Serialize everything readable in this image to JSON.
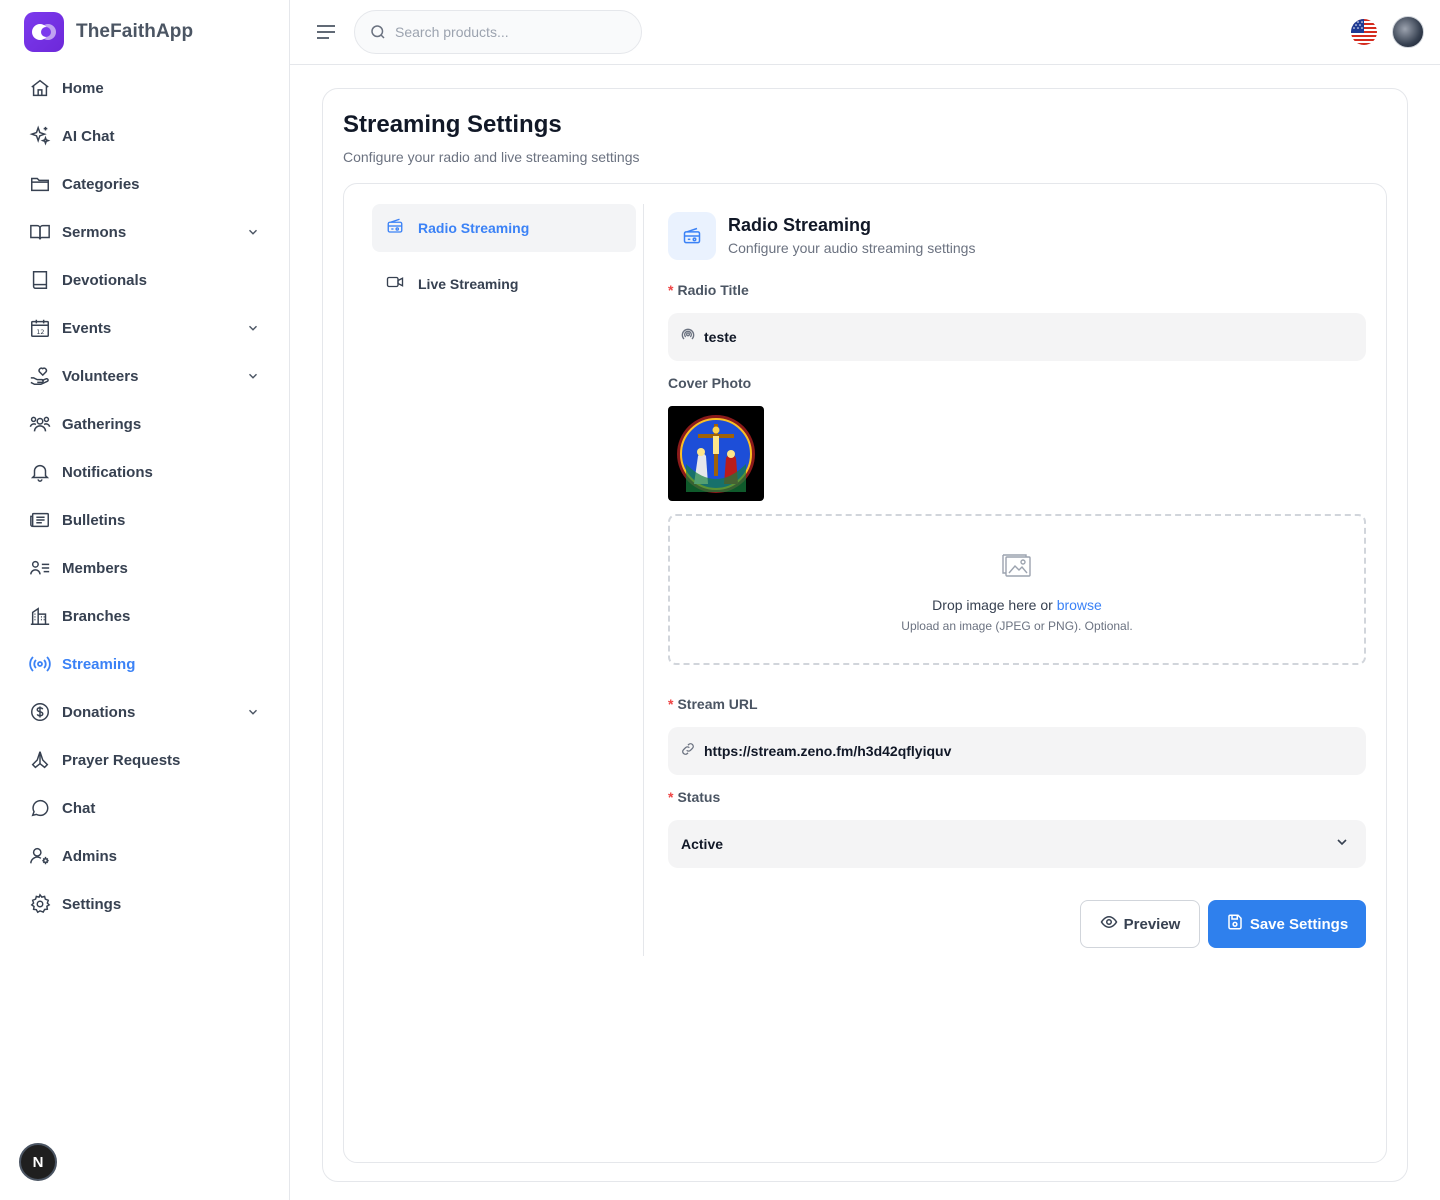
{
  "app": {
    "name": "TheFaithApp"
  },
  "search": {
    "placeholder": "Search products..."
  },
  "sidebar": {
    "items": [
      {
        "label": "Home",
        "icon": "home-icon"
      },
      {
        "label": "AI Chat",
        "icon": "sparkles-icon"
      },
      {
        "label": "Categories",
        "icon": "folder-icon"
      },
      {
        "label": "Sermons",
        "icon": "book-open-icon",
        "expandable": true
      },
      {
        "label": "Devotionals",
        "icon": "book-icon"
      },
      {
        "label": "Events",
        "icon": "calendar-icon",
        "expandable": true
      },
      {
        "label": "Volunteers",
        "icon": "hand-heart-icon",
        "expandable": true
      },
      {
        "label": "Gatherings",
        "icon": "users-icon"
      },
      {
        "label": "Notifications",
        "icon": "bell-icon"
      },
      {
        "label": "Bulletins",
        "icon": "newspaper-icon"
      },
      {
        "label": "Members",
        "icon": "user-list-icon"
      },
      {
        "label": "Branches",
        "icon": "building-icon"
      },
      {
        "label": "Streaming",
        "icon": "broadcast-icon",
        "active": true
      },
      {
        "label": "Donations",
        "icon": "dollar-circle-icon",
        "expandable": true
      },
      {
        "label": "Prayer Requests",
        "icon": "praying-hands-icon"
      },
      {
        "label": "Chat",
        "icon": "message-circle-icon"
      },
      {
        "label": "Admins",
        "icon": "user-cog-icon"
      },
      {
        "label": "Settings",
        "icon": "gear-icon"
      }
    ],
    "badge": "N"
  },
  "page": {
    "title": "Streaming Settings",
    "subtitle": "Configure your radio and live streaming settings"
  },
  "tabs": [
    {
      "label": "Radio Streaming",
      "icon": "radio-icon",
      "active": true
    },
    {
      "label": "Live Streaming",
      "icon": "video-icon"
    }
  ],
  "panel": {
    "title": "Radio Streaming",
    "subtitle": "Configure your audio streaming settings",
    "radio_title": {
      "label": "Radio Title",
      "value": "teste",
      "required": true
    },
    "cover_photo": {
      "label": "Cover Photo",
      "drop_text": "Drop image here or",
      "browse_text": "browse",
      "hint": "Upload an image (JPEG or PNG). Optional."
    },
    "stream_url": {
      "label": "Stream URL",
      "value": "https://stream.zeno.fm/h3d42qflyiquv",
      "required": true
    },
    "status": {
      "label": "Status",
      "value": "Active",
      "required": true
    },
    "buttons": {
      "preview": "Preview",
      "save": "Save Settings"
    }
  },
  "colors": {
    "accent": "#3b82f6",
    "brand": "#7c3aed",
    "save_button": "#2f80ed",
    "required": "#ef4444"
  }
}
